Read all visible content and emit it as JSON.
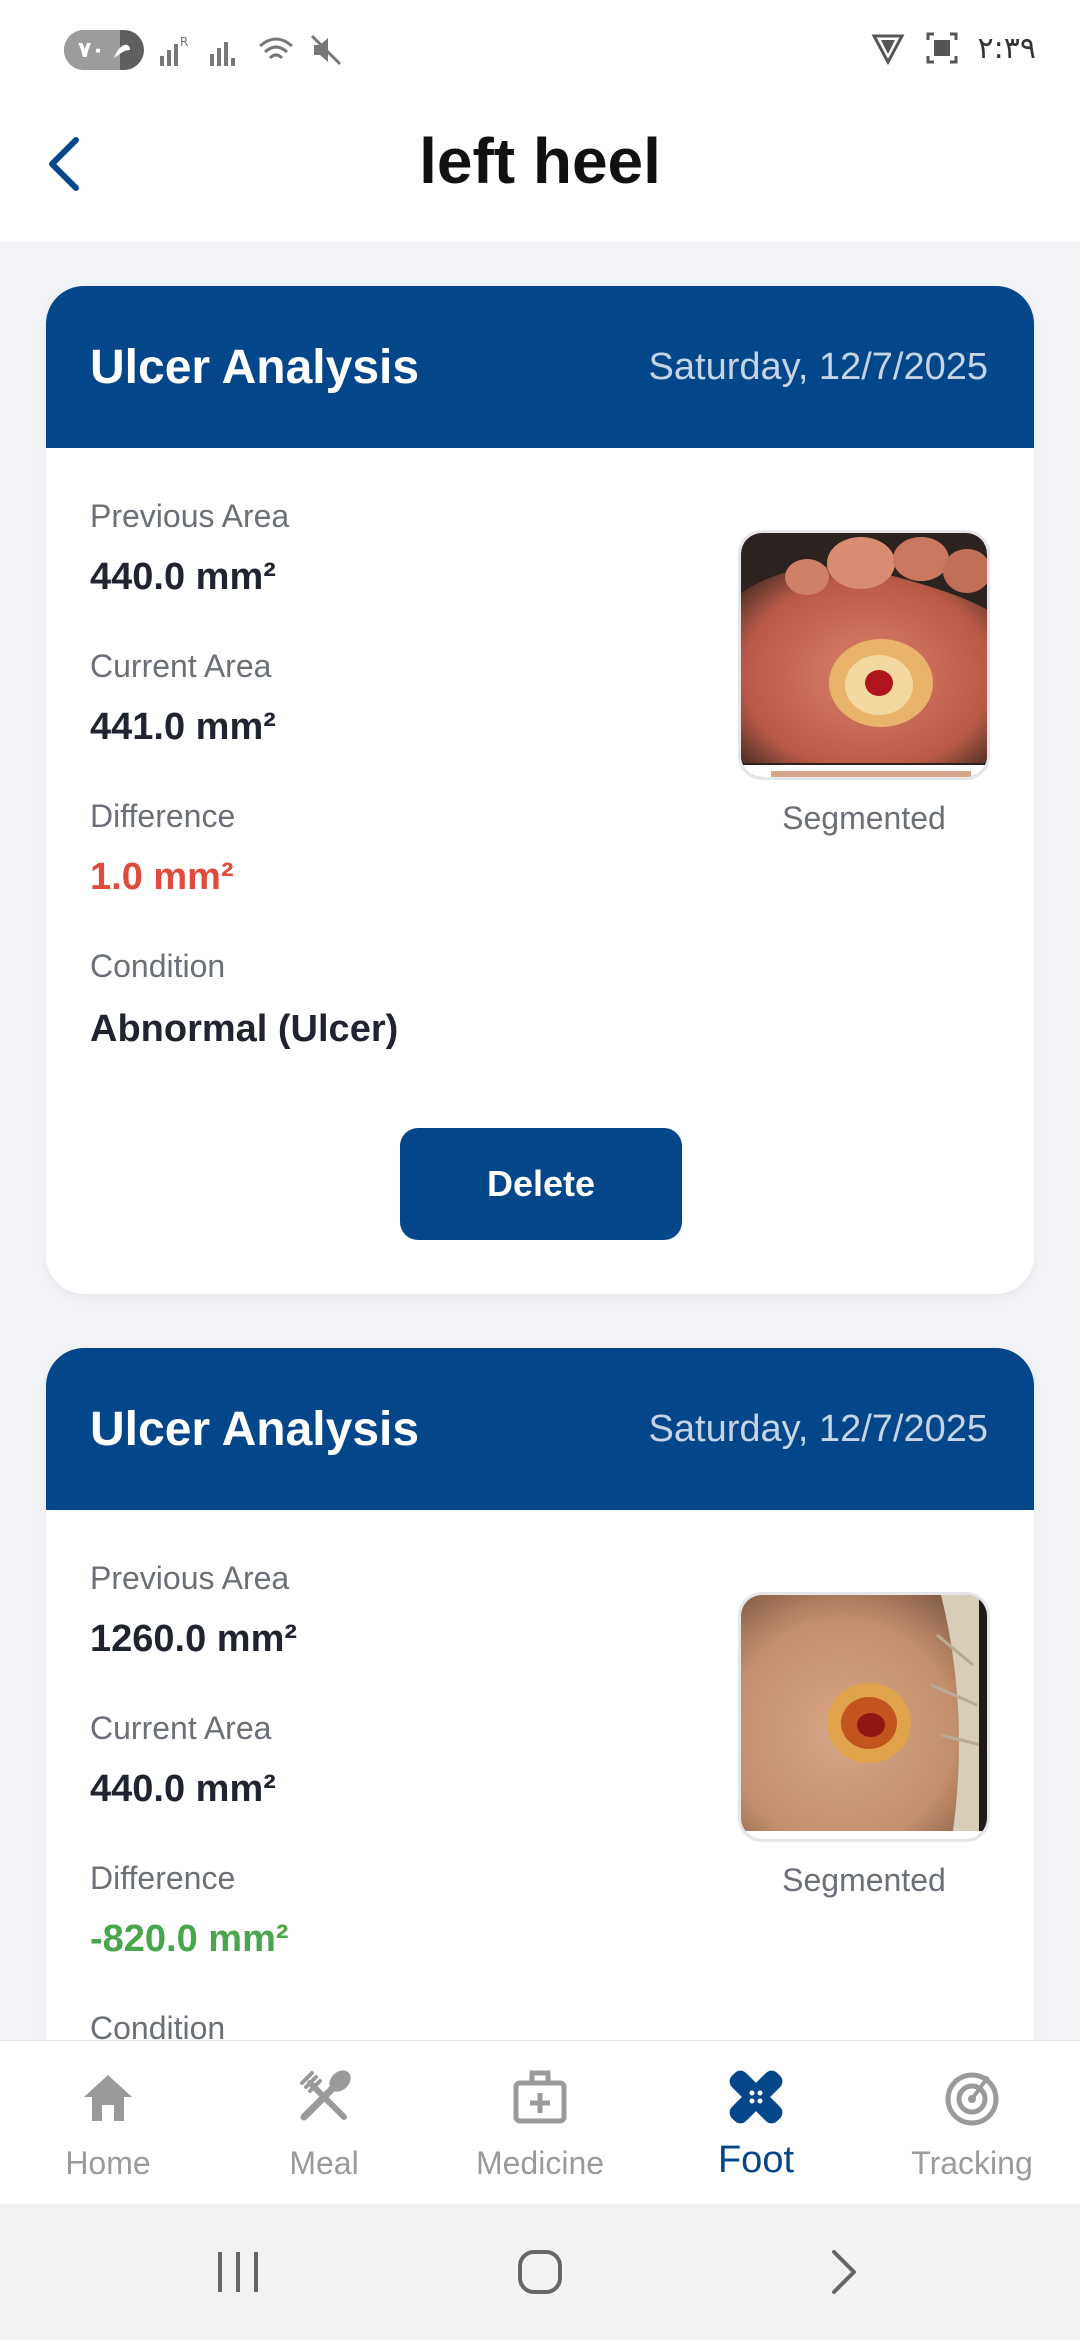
{
  "status": {
    "battery_level": 70,
    "battery_text": "٧٠",
    "time": "٢:٣٩"
  },
  "header": {
    "title": "left heel"
  },
  "cards": [
    {
      "title": "Ulcer Analysis",
      "date": "Saturday, 12/7/2025",
      "previous_area_label": "Previous Area",
      "previous_area": "440.0 mm²",
      "current_area_label": "Current Area",
      "current_area": "441.0 mm²",
      "difference_label": "Difference",
      "difference": "1.0 mm²",
      "difference_color": "#e04b3e",
      "condition_label": "Condition",
      "condition": "Abnormal (Ulcer)",
      "image_caption": "Segmented",
      "delete_label": "Delete"
    },
    {
      "title": "Ulcer Analysis",
      "date": "Saturday, 12/7/2025",
      "previous_area_label": "Previous Area",
      "previous_area": "1260.0 mm²",
      "current_area_label": "Current Area",
      "current_area": "440.0 mm²",
      "difference_label": "Difference",
      "difference": "-820.0 mm²",
      "difference_color": "#49a64d",
      "condition_label": "Condition",
      "image_caption": "Segmented"
    }
  ],
  "bottom_nav": {
    "items": [
      {
        "label": "Home",
        "icon": "home-icon"
      },
      {
        "label": "Meal",
        "icon": "fork-spoon-icon"
      },
      {
        "label": "Medicine",
        "icon": "medical-kit-icon"
      },
      {
        "label": "Foot",
        "icon": "bandage-icon",
        "active": true
      },
      {
        "label": "Tracking",
        "icon": "target-icon"
      }
    ]
  },
  "colors": {
    "primary": "#03478a",
    "background": "#f1f3f7",
    "negative": "#e04b3e",
    "positive": "#49a64d"
  }
}
